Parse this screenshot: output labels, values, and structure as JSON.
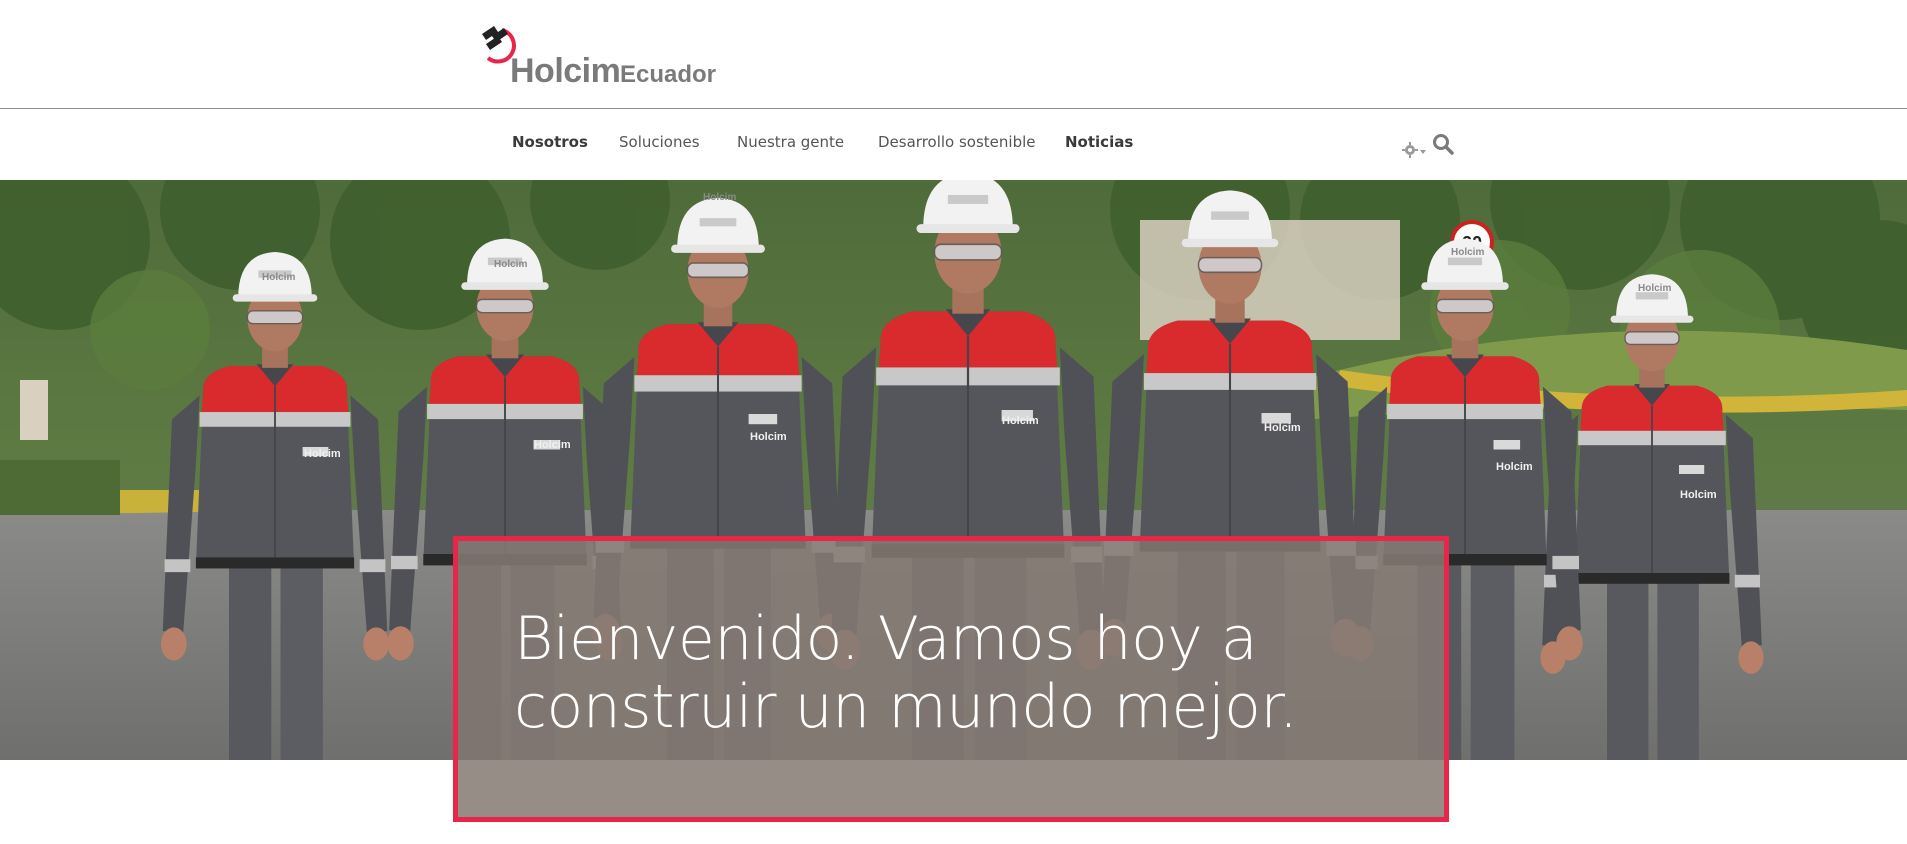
{
  "brand": {
    "name": "Holcim",
    "country": "Ecuador",
    "accent_red": "#e8264a",
    "logo_icon": "holcim-h-icon"
  },
  "nav": {
    "items": [
      {
        "label": "Nosotros",
        "bold": true
      },
      {
        "label": "Soluciones",
        "bold": false
      },
      {
        "label": "Nuestra gente",
        "bold": false
      },
      {
        "label": "Desarrollo sostenible",
        "bold": false
      },
      {
        "label": "Noticias",
        "bold": true
      }
    ],
    "tools": {
      "settings_icon": "gear-icon",
      "search_icon": "search-icon"
    }
  },
  "hero": {
    "headline": "Bienvenido. Vamos hoy a construir un mundo mejor.",
    "image_subject": "workers-in-uniforms-photo",
    "helmet_text": "Holcim",
    "shirt_text": "Holcim",
    "sign_text": "20"
  }
}
